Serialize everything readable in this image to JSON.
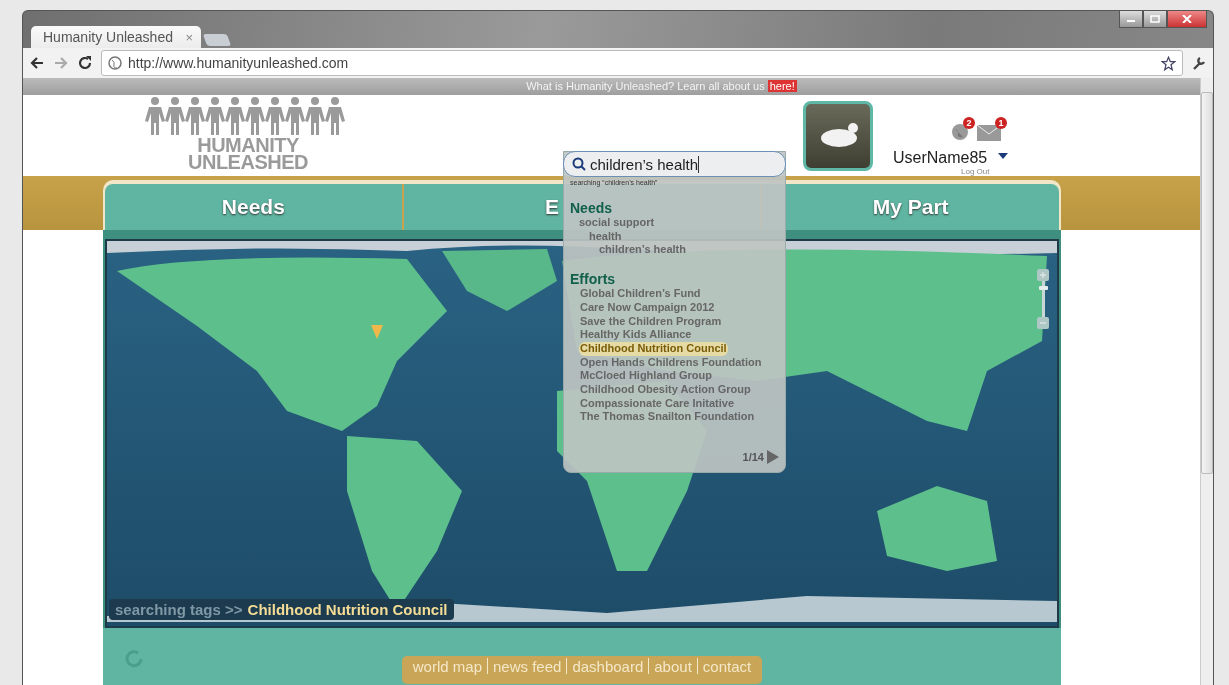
{
  "browser": {
    "tab_title": "Humanity Unleashed",
    "tab_close": "×",
    "url": "http://www.humanityunleashed.com"
  },
  "banner": {
    "text": "What is Humanity Unleashed? Learn all about us",
    "link": "here!"
  },
  "logo": {
    "line1": "HUMANITY",
    "line2": "UNLEASHED"
  },
  "search": {
    "value": "children’s health",
    "status": "searching “children’s health”"
  },
  "user": {
    "name": "UserName85",
    "logout": "Log Out",
    "notifications": [
      {
        "kind": "globe",
        "count": "2"
      },
      {
        "kind": "mail",
        "count": "1"
      }
    ]
  },
  "tabs": [
    {
      "label": "Needs"
    },
    {
      "label": "E"
    },
    {
      "label": "My Part"
    }
  ],
  "results": {
    "needs_title": "Needs",
    "needs": [
      {
        "label": "social support",
        "children": [
          {
            "label": "health",
            "children": [
              {
                "label": "children’s health"
              }
            ]
          }
        ]
      }
    ],
    "efforts_title": "Efforts",
    "efforts": [
      {
        "label": "Global Children’s Fund",
        "selected": false
      },
      {
        "label": "Care Now Campaign 2012",
        "selected": false
      },
      {
        "label": "Save the Children Program",
        "selected": false
      },
      {
        "label": "Healthy Kids Alliance",
        "selected": false
      },
      {
        "label": "Childhood Nutrition Council",
        "selected": true
      },
      {
        "label": "Open Hands Childrens Foundation",
        "selected": false
      },
      {
        "label": "McCloed Highland Group",
        "selected": false
      },
      {
        "label": "Childhood Obesity Action Group",
        "selected": false
      },
      {
        "label": "Compassionate Care Initative",
        "selected": false
      },
      {
        "label": "The Thomas Snailton Foundation",
        "selected": false
      }
    ],
    "pager": "1/14"
  },
  "map": {
    "zoom": {
      "level": 0.85
    },
    "tag_prefix": "searching tags >>",
    "tag": "Childhood Nutrition Council"
  },
  "footer_nav": [
    "world map",
    "news feed",
    "dashboard",
    "about",
    "contact"
  ]
}
